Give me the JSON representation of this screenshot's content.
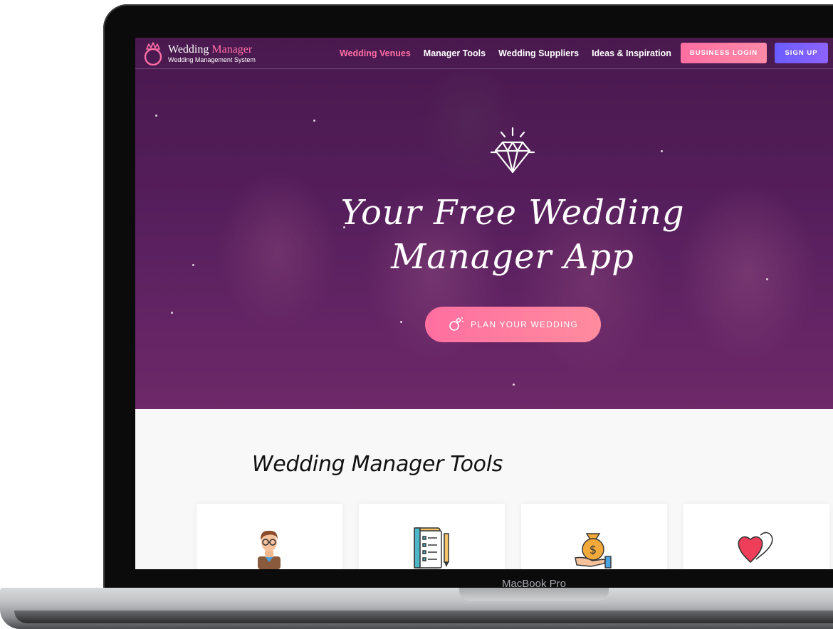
{
  "device": {
    "label": "MacBook Pro"
  },
  "header": {
    "logo": {
      "title_main": "Wedding ",
      "title_accent": "Manager",
      "subtitle": "Wedding Management System"
    },
    "nav": [
      {
        "label": "Wedding Venues",
        "active": true
      },
      {
        "label": "Manager Tools",
        "active": false
      },
      {
        "label": "Wedding Suppliers",
        "active": false
      },
      {
        "label": "Ideas & Inspiration",
        "active": false
      }
    ],
    "business_login_label": "BUSINESS LOGIN",
    "signup_label": "SIGN UP"
  },
  "hero": {
    "title_line1": "Your Free Wedding",
    "title_line2": "Manager App",
    "cta_label": "PLAN YOUR WEDDING"
  },
  "tools": {
    "title": "Wedding Manager Tools",
    "cards": [
      {
        "icon": "groom-avatar-icon"
      },
      {
        "icon": "checklist-notebook-icon"
      },
      {
        "icon": "money-bag-hand-icon"
      },
      {
        "icon": "two-hearts-icon"
      }
    ]
  },
  "colors": {
    "accent_pink": "#ff6fa6",
    "accent_purple": "#6a5cff",
    "hero_purple": "#5a2260"
  }
}
